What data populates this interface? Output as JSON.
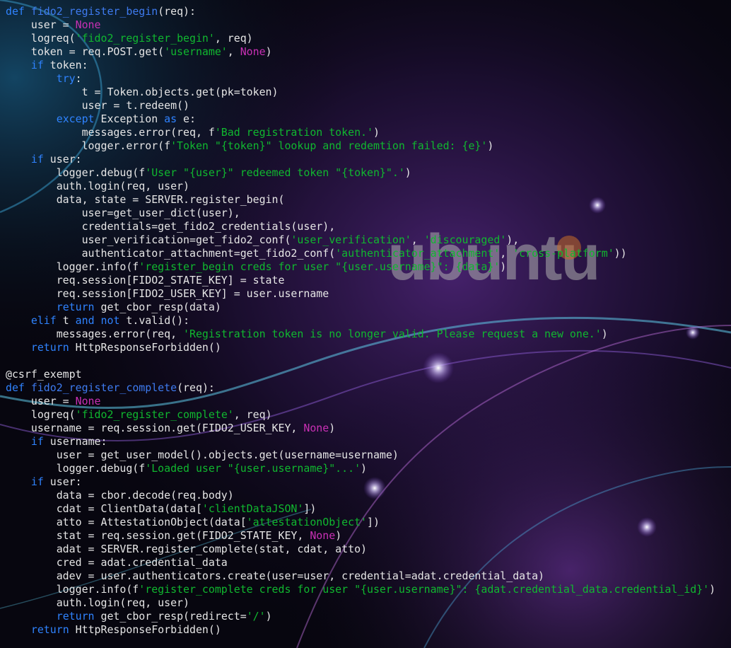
{
  "colors": {
    "keyword": "#2f83ff",
    "function_name": "#3e7bf0",
    "string": "#10b82f",
    "constant": "#c930b5",
    "default_text": "#e6e6e6",
    "background": "#07060f"
  },
  "wallpaper": {
    "watermark_text": "ubuntu"
  },
  "code": {
    "lines": [
      [
        {
          "t": "def ",
          "c": "k"
        },
        {
          "t": "fido2_register_begin",
          "c": "fn"
        },
        {
          "t": "(req):",
          "c": "p"
        }
      ],
      [
        {
          "t": "    user = ",
          "c": "p"
        },
        {
          "t": "None",
          "c": "n"
        }
      ],
      [
        {
          "t": "    logreq(",
          "c": "p"
        },
        {
          "t": "'fido2_register_begin'",
          "c": "s"
        },
        {
          "t": ", req)",
          "c": "p"
        }
      ],
      [
        {
          "t": "    token = req.POST.get(",
          "c": "p"
        },
        {
          "t": "'username'",
          "c": "s"
        },
        {
          "t": ", ",
          "c": "p"
        },
        {
          "t": "None",
          "c": "n"
        },
        {
          "t": ")",
          "c": "p"
        }
      ],
      [
        {
          "t": "    ",
          "c": "p"
        },
        {
          "t": "if",
          "c": "k"
        },
        {
          "t": " token:",
          "c": "p"
        }
      ],
      [
        {
          "t": "        ",
          "c": "p"
        },
        {
          "t": "try",
          "c": "k"
        },
        {
          "t": ":",
          "c": "p"
        }
      ],
      [
        {
          "t": "            t = Token.objects.get(pk=token)",
          "c": "p"
        }
      ],
      [
        {
          "t": "            user = t.redeem()",
          "c": "p"
        }
      ],
      [
        {
          "t": "        ",
          "c": "p"
        },
        {
          "t": "except",
          "c": "k"
        },
        {
          "t": " Exception ",
          "c": "p"
        },
        {
          "t": "as",
          "c": "k"
        },
        {
          "t": " e:",
          "c": "p"
        }
      ],
      [
        {
          "t": "            messages.error(req, f",
          "c": "p"
        },
        {
          "t": "'Bad registration token.'",
          "c": "s"
        },
        {
          "t": ")",
          "c": "p"
        }
      ],
      [
        {
          "t": "            logger.error(f",
          "c": "p"
        },
        {
          "t": "'Token \"{token}\" lookup and redemtion failed: {e}'",
          "c": "s"
        },
        {
          "t": ")",
          "c": "p"
        }
      ],
      [
        {
          "t": "    ",
          "c": "p"
        },
        {
          "t": "if",
          "c": "k"
        },
        {
          "t": " user:",
          "c": "p"
        }
      ],
      [
        {
          "t": "        logger.debug(f",
          "c": "p"
        },
        {
          "t": "'User \"{user}\" redeemed token \"{token}\".'",
          "c": "s"
        },
        {
          "t": ")",
          "c": "p"
        }
      ],
      [
        {
          "t": "        auth.login(req, user)",
          "c": "p"
        }
      ],
      [
        {
          "t": "        data, state = SERVER.register_begin(",
          "c": "p"
        }
      ],
      [
        {
          "t": "            user=get_user_dict(user),",
          "c": "p"
        }
      ],
      [
        {
          "t": "            credentials=get_fido2_credentials(user),",
          "c": "p"
        }
      ],
      [
        {
          "t": "            user_verification=get_fido2_conf(",
          "c": "p"
        },
        {
          "t": "'user_verification'",
          "c": "s"
        },
        {
          "t": ", ",
          "c": "p"
        },
        {
          "t": "'discouraged'",
          "c": "s"
        },
        {
          "t": "),",
          "c": "p"
        }
      ],
      [
        {
          "t": "            authenticator_attachment=get_fido2_conf(",
          "c": "p"
        },
        {
          "t": "'authenticator_attachment'",
          "c": "s"
        },
        {
          "t": ", ",
          "c": "p"
        },
        {
          "t": "'cross-platform'",
          "c": "s"
        },
        {
          "t": "))",
          "c": "p"
        }
      ],
      [
        {
          "t": "        logger.info(f",
          "c": "p"
        },
        {
          "t": "'register_begin creds for user \"{user.username}\": {data}'",
          "c": "s"
        },
        {
          "t": ")",
          "c": "p"
        }
      ],
      [
        {
          "t": "        req.session[FIDO2_STATE_KEY] = state",
          "c": "p"
        }
      ],
      [
        {
          "t": "        req.session[FIDO2_USER_KEY] = user.username",
          "c": "p"
        }
      ],
      [
        {
          "t": "        ",
          "c": "p"
        },
        {
          "t": "return",
          "c": "k"
        },
        {
          "t": " get_cbor_resp(data)",
          "c": "p"
        }
      ],
      [
        {
          "t": "    ",
          "c": "p"
        },
        {
          "t": "elif",
          "c": "k"
        },
        {
          "t": " t ",
          "c": "p"
        },
        {
          "t": "and",
          "c": "k"
        },
        {
          "t": " ",
          "c": "p"
        },
        {
          "t": "not",
          "c": "k"
        },
        {
          "t": " t.valid():",
          "c": "p"
        }
      ],
      [
        {
          "t": "        messages.error(req, ",
          "c": "p"
        },
        {
          "t": "'Registration token is no longer valid. Please request a new one.'",
          "c": "s"
        },
        {
          "t": ")",
          "c": "p"
        }
      ],
      [
        {
          "t": "    ",
          "c": "p"
        },
        {
          "t": "return",
          "c": "k"
        },
        {
          "t": " HttpResponseForbidden()",
          "c": "p"
        }
      ],
      [],
      [
        {
          "t": "@csrf_exempt",
          "c": "p"
        }
      ],
      [
        {
          "t": "def ",
          "c": "k"
        },
        {
          "t": "fido2_register_complete",
          "c": "fn"
        },
        {
          "t": "(req):",
          "c": "p"
        }
      ],
      [
        {
          "t": "    user = ",
          "c": "p"
        },
        {
          "t": "None",
          "c": "n"
        }
      ],
      [
        {
          "t": "    logreq(",
          "c": "p"
        },
        {
          "t": "'fido2_register_complete'",
          "c": "s"
        },
        {
          "t": ", req)",
          "c": "p"
        }
      ],
      [
        {
          "t": "    username = req.session.get(FIDO2_USER_KEY, ",
          "c": "p"
        },
        {
          "t": "None",
          "c": "n"
        },
        {
          "t": ")",
          "c": "p"
        }
      ],
      [
        {
          "t": "    ",
          "c": "p"
        },
        {
          "t": "if",
          "c": "k"
        },
        {
          "t": " username:",
          "c": "p"
        }
      ],
      [
        {
          "t": "        user = get_user_model().objects.get(username=username)",
          "c": "p"
        }
      ],
      [
        {
          "t": "        logger.debug(f",
          "c": "p"
        },
        {
          "t": "'Loaded user \"{user.username}\"...'",
          "c": "s"
        },
        {
          "t": ")",
          "c": "p"
        }
      ],
      [
        {
          "t": "    ",
          "c": "p"
        },
        {
          "t": "if",
          "c": "k"
        },
        {
          "t": " user:",
          "c": "p"
        }
      ],
      [
        {
          "t": "        data = cbor.decode(req.body)",
          "c": "p"
        }
      ],
      [
        {
          "t": "        cdat = ClientData(data[",
          "c": "p"
        },
        {
          "t": "'clientDataJSON'",
          "c": "s"
        },
        {
          "t": "])",
          "c": "p"
        }
      ],
      [
        {
          "t": "        atto = AttestationObject(data[",
          "c": "p"
        },
        {
          "t": "'attestationObject'",
          "c": "s"
        },
        {
          "t": "])",
          "c": "p"
        }
      ],
      [
        {
          "t": "        stat = req.session.get(FIDO2_STATE_KEY, ",
          "c": "p"
        },
        {
          "t": "None",
          "c": "n"
        },
        {
          "t": ")",
          "c": "p"
        }
      ],
      [
        {
          "t": "        adat = SERVER.register_complete(stat, cdat, atto)",
          "c": "p"
        }
      ],
      [
        {
          "t": "        cred = adat.credential_data",
          "c": "p"
        }
      ],
      [
        {
          "t": "        adev = user.authenticators.create(user=user, credential=adat.credential_data)",
          "c": "p"
        }
      ],
      [
        {
          "t": "        logger.info(f",
          "c": "p"
        },
        {
          "t": "'register_complete creds for user \"{user.username}\": {adat.credential_data.credential_id}'",
          "c": "s"
        },
        {
          "t": ")",
          "c": "p"
        }
      ],
      [
        {
          "t": "        auth.login(req, user)",
          "c": "p"
        }
      ],
      [
        {
          "t": "        ",
          "c": "p"
        },
        {
          "t": "return",
          "c": "k"
        },
        {
          "t": " get_cbor_resp(redirect=",
          "c": "p"
        },
        {
          "t": "'/'",
          "c": "s"
        },
        {
          "t": ")",
          "c": "p"
        }
      ],
      [
        {
          "t": "    ",
          "c": "p"
        },
        {
          "t": "return",
          "c": "k"
        },
        {
          "t": " HttpResponseForbidden()",
          "c": "p"
        }
      ]
    ]
  }
}
